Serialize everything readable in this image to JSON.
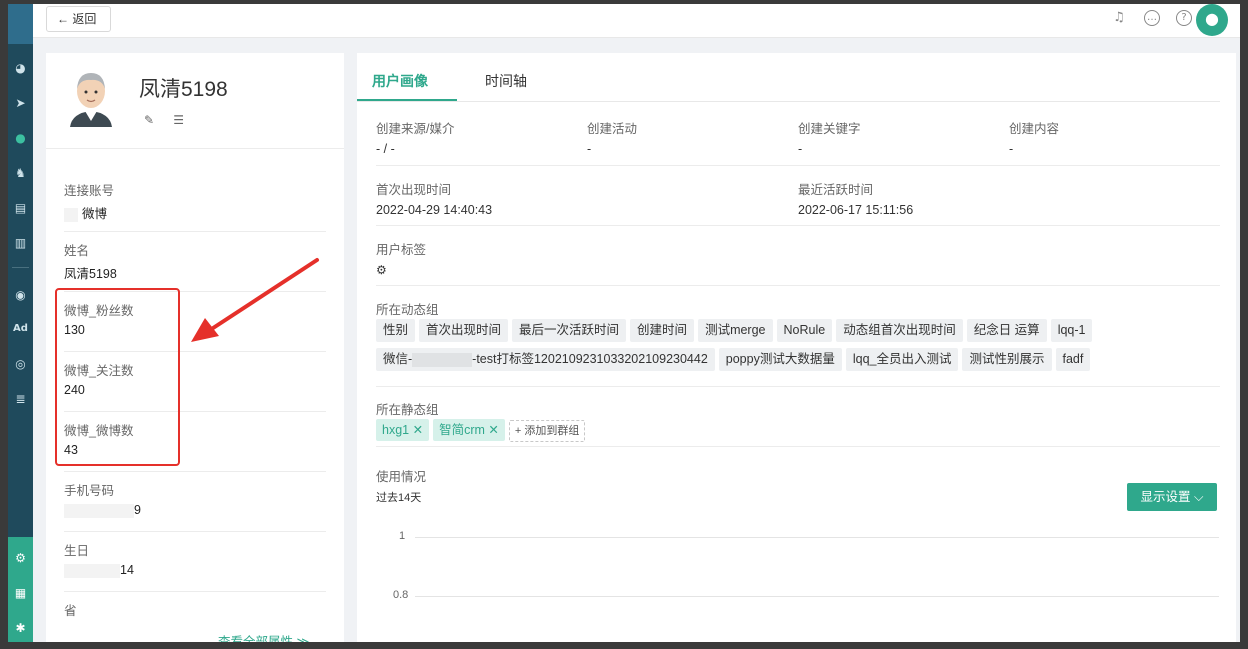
{
  "topbar": {
    "back_label": "← 返回",
    "avatar_icon": "user-icon"
  },
  "profile": {
    "name": "凤清5198"
  },
  "attrs": [
    {
      "label": "连接账号",
      "value": "微博"
    },
    {
      "label": "姓名",
      "value": "凤清5198"
    },
    {
      "label": "微博_粉丝数",
      "value": "130"
    },
    {
      "label": "微博_关注数",
      "value": "240"
    },
    {
      "label": "微博_微博数",
      "value": "43"
    },
    {
      "label": "手机号码",
      "value": "9"
    },
    {
      "label": "生日",
      "value": "14"
    },
    {
      "label": "省",
      "value": ""
    }
  ],
  "view_all": "查看全部属性 ≫",
  "tabs": [
    "用户画像",
    "时间轴"
  ],
  "portrait": {
    "source_label": "创建来源/媒介",
    "source_value": "- / -",
    "activity_label": "创建活动",
    "activity_value": "-",
    "keyword_label": "创建关键字",
    "keyword_value": "-",
    "content_label": "创建内容",
    "content_value": "-",
    "first_seen_label": "首次出现时间",
    "first_seen_value": "2022-04-29 14:40:43",
    "last_active_label": "最近活跃时间",
    "last_active_value": "2022-06-17 15:11:56",
    "tags_label": "用户标签",
    "dynamic_label": "所在动态组",
    "dynamic_row1": [
      "性别",
      "首次出现时间",
      "最后一次活跃时间",
      "创建时间",
      "测试merge",
      "NoRule",
      "动态组首次出现时间",
      "纪念日 运算",
      "lqq-1"
    ],
    "dynamic_row2": [
      "微信-",
      "-test打标签12021092310332021092304​42",
      "poppy测试大数据量",
      "lqq_全员出入测试",
      "测试性别展示",
      "fadf"
    ],
    "static_label": "所在静态组",
    "static_groups": [
      "hxg1 ✕",
      "智简crm ✕"
    ],
    "add_group": "+ 添加到群组",
    "usage_label": "使用情况",
    "usage_period": "过去14天",
    "display_settings": "显示设置  ⌵",
    "y_ticks": [
      "1",
      "0.8"
    ]
  }
}
